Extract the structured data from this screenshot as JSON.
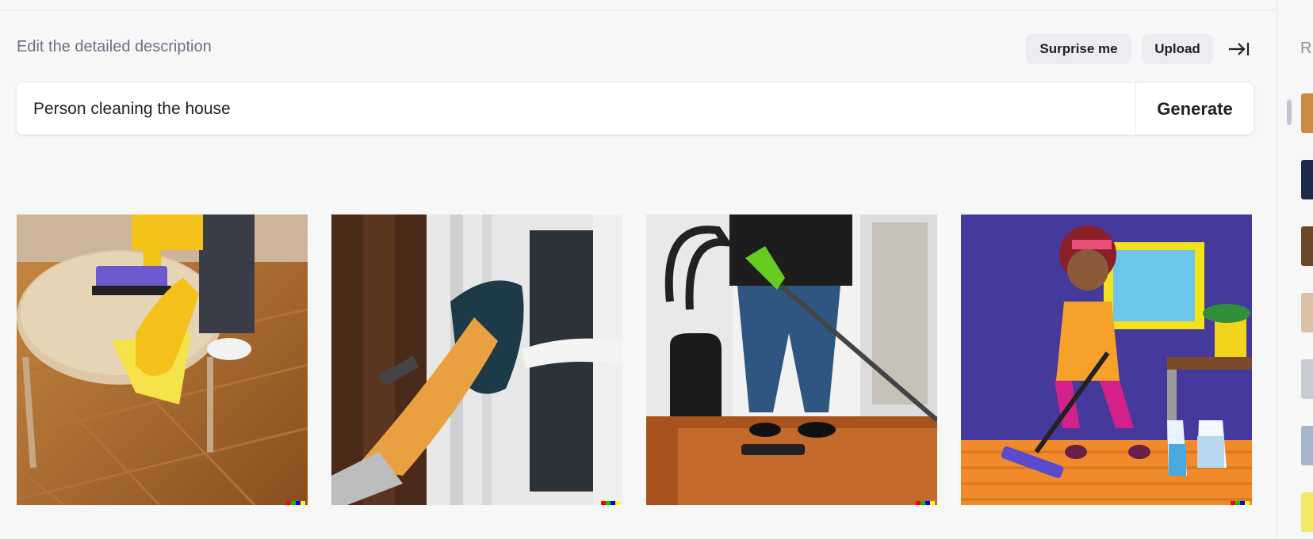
{
  "editor": {
    "label": "Edit the detailed description",
    "surprise_label": "Surprise me",
    "upload_label": "Upload",
    "prompt_value": "Person cleaning the house",
    "generate_label": "Generate"
  },
  "results": {
    "images": [
      {
        "subject": "gloved hand wiping a round wooden table"
      },
      {
        "subject": "gloved hand cleaning a white window frame"
      },
      {
        "subject": "person vacuuming a wooden floor"
      },
      {
        "subject": "cartoon woman mopping an orange floor"
      }
    ]
  },
  "history": {
    "title": "R"
  },
  "icons": {
    "collapse": "arrow-right-to-line-icon"
  },
  "colors": {
    "page_bg": "#f7f7f8",
    "pill_bg": "#ececf1",
    "text": "#202123",
    "muted": "#6e6e80"
  }
}
